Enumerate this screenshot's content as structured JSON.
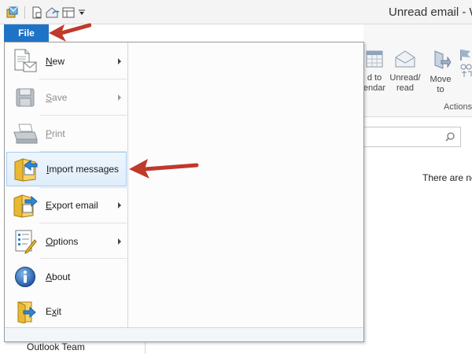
{
  "window": {
    "title": "Unread email - W"
  },
  "quick_access": [
    "app-icon",
    "new-page-icon",
    "reply-icon",
    "layout-icon",
    "dropdown-icon"
  ],
  "file_tab": {
    "label": "File"
  },
  "file_menu": {
    "items": [
      {
        "id": "new",
        "label": "New",
        "accel": "N",
        "icon": "new-document-icon",
        "submenu": true,
        "enabled": true
      },
      {
        "id": "save",
        "label": "Save",
        "accel": "S",
        "icon": "floppy-disk-icon",
        "submenu": true,
        "enabled": false
      },
      {
        "id": "print",
        "label": "Print",
        "accel": "P",
        "icon": "printer-icon",
        "submenu": false,
        "enabled": false
      },
      {
        "id": "import",
        "label": "Import messages",
        "accel": "I",
        "icon": "import-folder-icon",
        "submenu": false,
        "enabled": true,
        "highlighted": true
      },
      {
        "id": "export",
        "label": "Export email",
        "accel": "E",
        "icon": "export-folder-icon",
        "submenu": true,
        "enabled": true
      },
      {
        "id": "options",
        "label": "Options",
        "accel": "O",
        "icon": "options-checklist-icon",
        "submenu": true,
        "enabled": true
      },
      {
        "id": "about",
        "label": "About",
        "accel": "A",
        "icon": "info-icon",
        "submenu": false,
        "enabled": true
      },
      {
        "id": "exit",
        "label": "Exit",
        "accel": "x",
        "icon": "exit-door-icon",
        "submenu": false,
        "enabled": true
      }
    ]
  },
  "ribbon": {
    "buttons": [
      {
        "label_line1": "d to",
        "label_line2": "endar",
        "icon": "calendar-icon"
      },
      {
        "label_line1": "Unread/",
        "label_line2": "read",
        "icon": "envelope-open-icon"
      },
      {
        "label_line1": "Move",
        "label_line2": "to",
        "icon": "move-folder-icon"
      },
      {
        "label_line1": "",
        "label_line2": "",
        "icon": "flag-icon"
      }
    ],
    "group_label": "Actions"
  },
  "message_list": {
    "empty_text": "There are no"
  },
  "folder_pane": {
    "item": "Outlook Team"
  },
  "colors": {
    "file_tab": "#1f73c6",
    "annotation_arrow": "#c0392b",
    "highlight_border": "#a9cdf0"
  }
}
